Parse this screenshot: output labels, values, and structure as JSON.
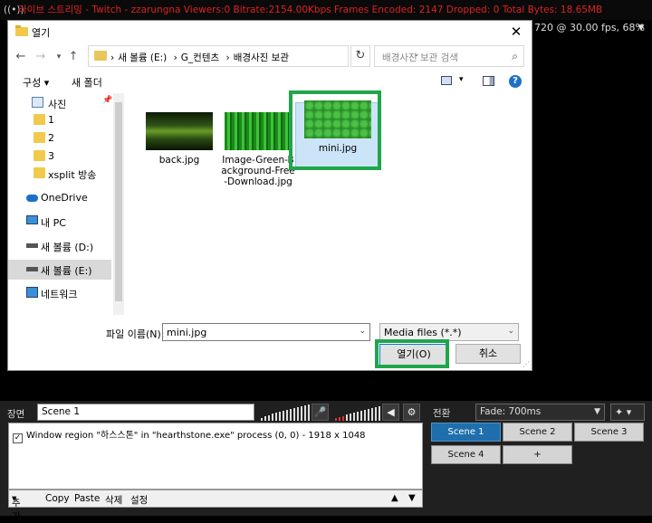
{
  "topbar": {
    "title": "라이브 스트리밍 - Twitch - zzarungna  Viewers:0  Bitrate:2154.00Kbps  Frames Encoded: 2147  Dropped: 0  Total Bytes: 18.65MB",
    "resolution": "720 @ 30.00 fps, 68%"
  },
  "dialog": {
    "title": "열기",
    "breadcrumb": [
      "새 볼륨 (E:)",
      "G_컨텐츠",
      "배경사진 보관"
    ],
    "search_placeholder": "배경사진 보관 검색",
    "toolbar": {
      "organize": "구성",
      "new_folder": "새 폴더"
    },
    "nav_items": [
      {
        "label": "사진",
        "icon": "pictures-icon"
      },
      {
        "label": "1",
        "icon": "folder-icon"
      },
      {
        "label": "2",
        "icon": "folder-icon"
      },
      {
        "label": "3",
        "icon": "folder-icon"
      },
      {
        "label": "xsplit 방송",
        "icon": "folder-icon"
      },
      {
        "label": "OneDrive",
        "icon": "cloud-icon"
      },
      {
        "label": "내 PC",
        "icon": "pc-icon"
      },
      {
        "label": "새 볼륨 (D:)",
        "icon": "drive-icon"
      },
      {
        "label": "새 볼륨 (E:)",
        "icon": "drive-icon"
      },
      {
        "label": "네트워크",
        "icon": "network-icon"
      }
    ],
    "files": [
      {
        "name": "back.jpg"
      },
      {
        "name": "Image-Green-Background-Free-Download.jpg"
      },
      {
        "name": "mini.jpg"
      }
    ],
    "filename_label": "파일 이름(N):",
    "filename_value": "mini.jpg",
    "filter": "Media files (*.*)",
    "open_button": "열기(O)",
    "cancel_button": "취소"
  },
  "panel": {
    "scene_label": "장면",
    "scene_name": "Scene 1",
    "source_item": "Window region \"하스스톤\" in \"hearthstone.exe\" process (0, 0) - 1918 x 1048",
    "source_actions": [
      "추가",
      "Copy",
      "Paste",
      "삭제",
      "설정"
    ],
    "transition_label": "전환",
    "transition_value": "Fade: 700ms",
    "scenes": [
      "Scene 1",
      "Scene 2",
      "Scene 3",
      "Scene 4",
      "+"
    ],
    "active_scene": "Scene 1"
  },
  "colors": {
    "highlight": "#1fa64a",
    "active_scene": "#1f6fad",
    "status_text": "#dd2222"
  }
}
